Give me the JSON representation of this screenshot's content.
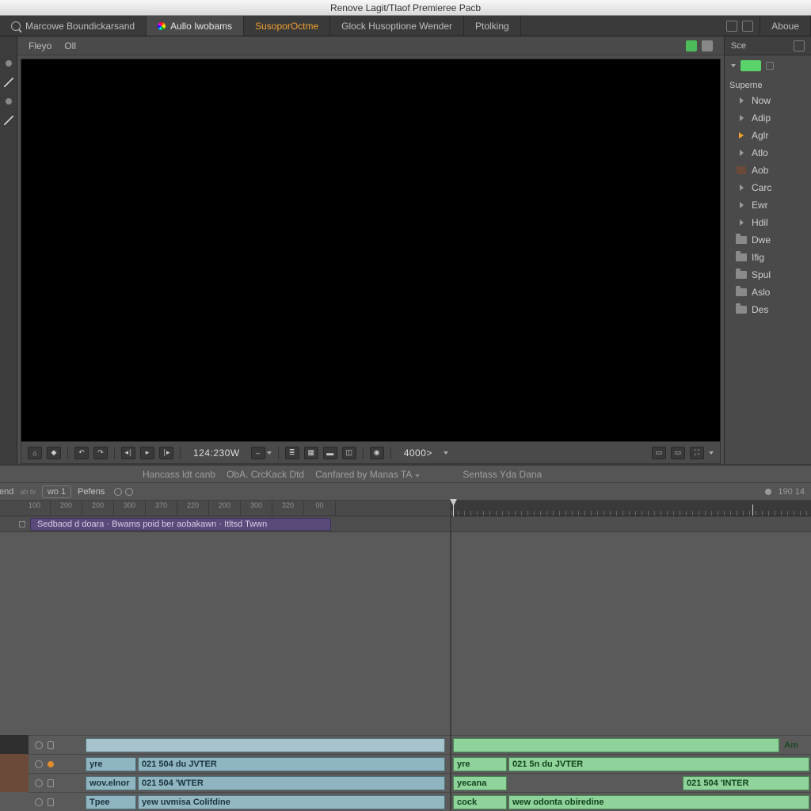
{
  "titlebar": {
    "text": "Renove Lagit/Tlaof Premieree Pacb"
  },
  "workspaces": {
    "tabs": [
      {
        "icon": "search",
        "label": "Marcowe Boundickarsand"
      },
      {
        "icon": "color",
        "label": "Aullo Iwobams"
      },
      {
        "icon": "none",
        "label": "SusoporOctme",
        "highlight": "orange"
      },
      {
        "icon": "none",
        "label": "Glock Husoptione Wender"
      },
      {
        "icon": "none",
        "label": "Ptolking"
      }
    ],
    "right_label": "Aboue"
  },
  "center_optbar": {
    "left1": "Fleyo",
    "left2": "Oll"
  },
  "playbar": {
    "timecode": "124:230W",
    "rate": "4000>"
  },
  "rpanel": {
    "header": "Sce",
    "section": "Superne",
    "items": [
      {
        "icon": "tri",
        "label": "Now"
      },
      {
        "icon": "tri",
        "label": "Adip"
      },
      {
        "icon": "arrowy",
        "label": "Aglr"
      },
      {
        "icon": "tri",
        "label": "Atlo"
      },
      {
        "icon": "brown",
        "label": "Aob"
      },
      {
        "icon": "tri",
        "label": "Carc"
      },
      {
        "icon": "tri",
        "label": "Ewr"
      },
      {
        "icon": "tri",
        "label": "Hdil"
      },
      {
        "icon": "folder",
        "label": "Dwe"
      },
      {
        "icon": "folder",
        "label": "Ifig"
      },
      {
        "icon": "folder",
        "label": "Spul"
      },
      {
        "icon": "folder",
        "label": "Aslo"
      },
      {
        "icon": "folder",
        "label": "Des"
      }
    ]
  },
  "lower_infobar": {
    "a": "Hancass ldt canb",
    "b": "ObA. CrcKack Dtd",
    "c": "Canfared by Manas TA",
    "d": "Sentass Yda Dana"
  },
  "lower_toolbar": {
    "label": "Il Repboend",
    "chip": "wo 1",
    "menu": "Pefens",
    "right_num": "190 14"
  },
  "ruler_left": [
    "100",
    "200",
    "200",
    "300",
    "370",
    "220",
    "200",
    "300",
    "320",
    "00"
  ],
  "purple_clip": "Sedbaod d doara · Bwams poid ber aobakawn · Itltsd Twwn",
  "left_layers": [
    {
      "name": "yre",
      "value": "021 504 du JVTER"
    },
    {
      "name": "wov.elnor",
      "value": "021 504 'WTER"
    },
    {
      "name": "Tpee",
      "value": "yew uvmisa Colifdine"
    }
  ],
  "right_top_label": "Am",
  "right_layers": [
    {
      "a": "yre",
      "b": "021 5n du JVTER"
    },
    {
      "a": "yecana",
      "b": "021 504 'INTER",
      "split": true
    },
    {
      "a": "cock",
      "b": "wew odonta obiredine"
    }
  ]
}
